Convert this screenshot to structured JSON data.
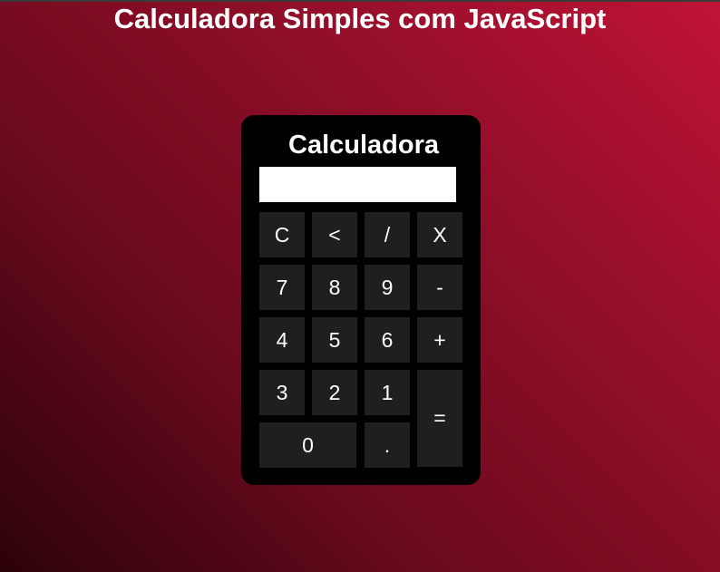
{
  "page": {
    "title": "Calculadora Simples com JavaScript"
  },
  "calculator": {
    "title": "Calculadora",
    "display_value": "",
    "keys": {
      "clear": "C",
      "backspace": "<",
      "divide": "/",
      "multiply": "X",
      "seven": "7",
      "eight": "8",
      "nine": "9",
      "minus": "-",
      "four": "4",
      "five": "5",
      "six": "6",
      "plus": "+",
      "three": "3",
      "two": "2",
      "one": "1",
      "equals": "=",
      "zero": "0",
      "decimal": "."
    }
  },
  "colors": {
    "background_light": "#c01335",
    "background_dark": "#2c0209",
    "calculator_body": "#000000",
    "key_background": "#1f1f1f",
    "text": "#ffffff"
  }
}
